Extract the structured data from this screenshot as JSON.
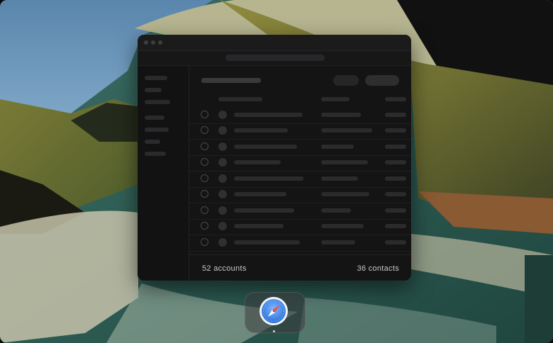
{
  "footer": {
    "accounts_label": "52 accounts",
    "contacts_label": "36 contacts"
  },
  "dock": {
    "apps": [
      {
        "icon": "compass-icon",
        "running": true
      }
    ]
  },
  "list": {
    "row_count": 9
  },
  "colors": {
    "window_bg": "#141415",
    "accent_blue": "#3d8bf0",
    "footer_text": "#c9c9cc"
  }
}
